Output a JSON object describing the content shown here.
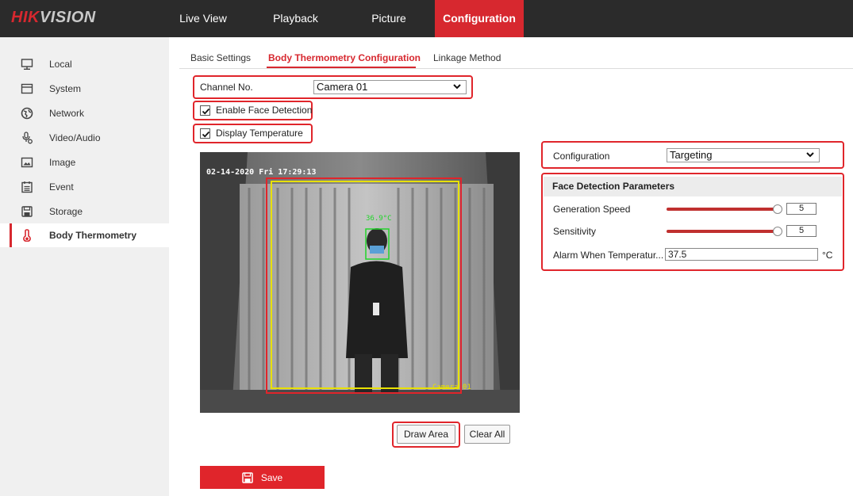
{
  "brand": {
    "hik": "HIK",
    "vision": "VISION"
  },
  "nav": [
    {
      "label": "Live View",
      "active": false
    },
    {
      "label": "Playback",
      "active": false
    },
    {
      "label": "Picture",
      "active": false
    },
    {
      "label": "Configuration",
      "active": true
    }
  ],
  "sidebar": {
    "items": [
      {
        "label": "Local",
        "icon": "monitor-icon"
      },
      {
        "label": "System",
        "icon": "system-icon"
      },
      {
        "label": "Network",
        "icon": "globe-icon"
      },
      {
        "label": "Video/Audio",
        "icon": "mic-icon"
      },
      {
        "label": "Image",
        "icon": "image-icon"
      },
      {
        "label": "Event",
        "icon": "event-icon"
      },
      {
        "label": "Storage",
        "icon": "storage-icon"
      },
      {
        "label": "Body Thermometry",
        "icon": "thermometer-icon",
        "active": true
      }
    ]
  },
  "tabs": [
    {
      "label": "Basic Settings"
    },
    {
      "label": "Body Thermometry Configuration",
      "active": true
    },
    {
      "label": "Linkage Method"
    }
  ],
  "form": {
    "channel_label": "Channel No.",
    "channel_value": "Camera 01",
    "enable_face_label": "Enable Face Detection",
    "enable_face_checked": true,
    "display_temp_label": "Display Temperature",
    "display_temp_checked": true
  },
  "video": {
    "timestamp": "02-14-2020 Fri 17:29:13",
    "temp_overlay": "36.9°C",
    "camera_name": "Camera 01"
  },
  "buttons": {
    "draw_area": "Draw Area",
    "clear_all": "Clear All",
    "save": "Save"
  },
  "right_panel": {
    "configuration_label": "Configuration",
    "configuration_value": "Targeting",
    "face_params_title": "Face Detection Parameters",
    "generation_speed_label": "Generation Speed",
    "generation_speed_value": "5",
    "sensitivity_label": "Sensitivity",
    "sensitivity_value": "5",
    "alarm_label": "Alarm When Temperatur...",
    "alarm_value": "37.5",
    "alarm_unit": "°C"
  },
  "colors": {
    "accent": "#d7282f",
    "topbar": "#2b2b2b",
    "sidebar": "#f0f0f0"
  }
}
